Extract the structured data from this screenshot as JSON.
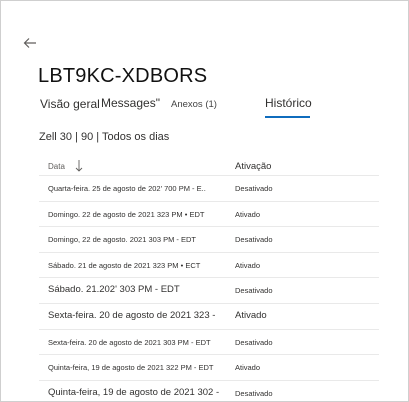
{
  "device": {
    "title": "LBT9KC-XDBORS"
  },
  "tabs": [
    {
      "label": "Visão geral"
    },
    {
      "label": "Messages\""
    },
    {
      "label": "Anexos (1)"
    },
    {
      "label": "Histórico",
      "active": true
    }
  ],
  "filter": {
    "label": "Zell 30 | 90 | Todos os dias"
  },
  "table": {
    "headers": {
      "date": "Data",
      "status": "Ativação"
    },
    "rows": [
      {
        "date": "Quarta-feira. 25 de agosto de 202' 700 PM - E..",
        "status": "Desativado",
        "large": false
      },
      {
        "date": "Domingo. 22 de agosto de 2021 323 PM • EDT",
        "status": "Ativado",
        "large": false
      },
      {
        "date": "Domingo, 22 de agosto. 2021 303 PM - EDT",
        "status": "Desativado",
        "large": false
      },
      {
        "date": "Sábado. 21 de agosto de 2021 323 PM • ECT",
        "status": "Ativado",
        "large": false
      },
      {
        "date": "Sábado. 21.202' 303 PM -                 EDT",
        "status": "Desativado",
        "large": true
      },
      {
        "date": "Sexta-feira. 20 de agosto de 2021 323 -",
        "status": "Ativado",
        "large": true
      },
      {
        "date": "Sexta-feira. 20 de agosto de 2021 303 PM - EDT",
        "status": "Desativado",
        "large": false
      },
      {
        "date": "Quinta-feira, 19 de agosto de 2021 322 PM - EDT",
        "status": "Ativado",
        "large": false
      },
      {
        "date": "Quinta-feira, 19 de agosto de 2021 302 -",
        "status": "Desativado",
        "large": true
      }
    ]
  },
  "colors": {
    "accent": "#0f6cbd",
    "text": "#201f1e",
    "divider": "#e9e9e9"
  }
}
